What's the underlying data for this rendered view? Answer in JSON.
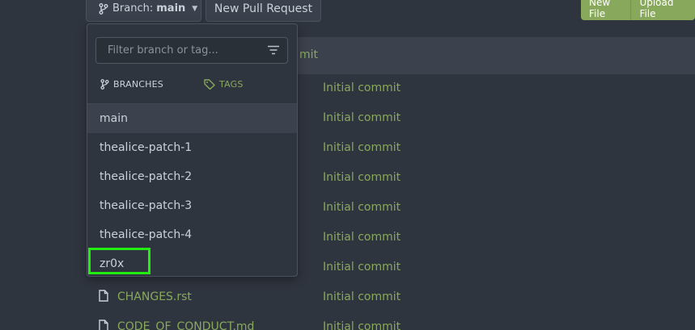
{
  "toolbar": {
    "branch_prefix": "Branch:",
    "branch_name": "main",
    "new_pull_request": "New Pull Request",
    "new_file": "New File",
    "upload_file": "Upload File"
  },
  "table": {
    "header_commit_partial": "mit",
    "rows": [
      {
        "name": "",
        "commit": "Initial commit"
      },
      {
        "name": "",
        "commit": "Initial commit"
      },
      {
        "name": "",
        "commit": "Initial commit"
      },
      {
        "name": "",
        "commit": "Initial commit"
      },
      {
        "name": "",
        "commit": "Initial commit"
      },
      {
        "name": "",
        "commit": "Initial commit"
      },
      {
        "name": "",
        "commit": "Initial commit"
      },
      {
        "name": "CHANGES.rst",
        "commit": "Initial commit"
      },
      {
        "name": "CODE_OF_CONDUCT.md",
        "commit": "Initial commit"
      }
    ]
  },
  "dropdown": {
    "filter_placeholder": "Filter branch or tag...",
    "tab_branches": "BRANCHES",
    "tab_tags": "TAGS",
    "branches": [
      "main",
      "thealice-patch-1",
      "thealice-patch-2",
      "thealice-patch-3",
      "thealice-patch-4",
      "zr0x"
    ],
    "selected_branch": "main"
  },
  "colors": {
    "background": "#2f353f",
    "accent_green": "#88a85b",
    "highlight_box": "#22ee11"
  }
}
